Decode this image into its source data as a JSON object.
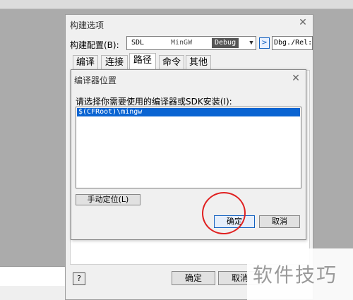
{
  "outer_dialog": {
    "title": "构建选项",
    "close_glyph": "✕",
    "config_label": "构建配置(B):",
    "config_sdl": "SDL",
    "config_mingw": "MinGW",
    "config_debug": "Debug",
    "config_arrow": "▼",
    "config_next": ">",
    "config_mode": "Dbg./Rel:",
    "tabs": [
      {
        "label": "编译"
      },
      {
        "label": "连接"
      },
      {
        "label": "路径"
      },
      {
        "label": "命令"
      },
      {
        "label": "其他"
      }
    ],
    "help_label": "?",
    "ok_label": "确定",
    "cancel_label": "取消"
  },
  "inner_dialog": {
    "title": "编译器位置",
    "close_glyph": "✕",
    "prompt": "请选择你需要使用的编译器或SDK安装(I):",
    "list_items": [
      "$(CFRoot)\\mingw"
    ],
    "manual_locate_label": "手动定位(L)",
    "ok_label": "确定",
    "cancel_label": "取消"
  },
  "watermark": {
    "text": "软件技巧"
  },
  "colors": {
    "accent": "#0a64d2",
    "annotation": "#e02020",
    "background": "#ababab"
  }
}
